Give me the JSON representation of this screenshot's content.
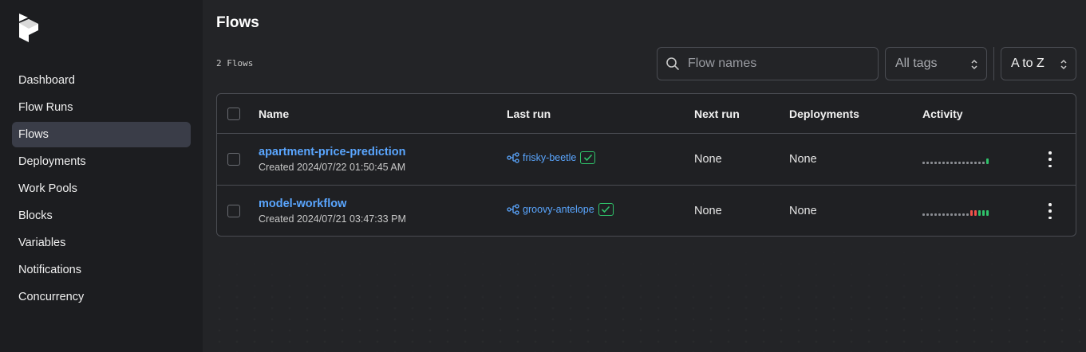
{
  "sidebar": {
    "items": [
      {
        "label": "Dashboard",
        "active": false
      },
      {
        "label": "Flow Runs",
        "active": false
      },
      {
        "label": "Flows",
        "active": true
      },
      {
        "label": "Deployments",
        "active": false
      },
      {
        "label": "Work Pools",
        "active": false
      },
      {
        "label": "Blocks",
        "active": false
      },
      {
        "label": "Variables",
        "active": false
      },
      {
        "label": "Notifications",
        "active": false
      },
      {
        "label": "Concurrency",
        "active": false
      }
    ]
  },
  "page": {
    "title": "Flows",
    "count_label": "2 Flows"
  },
  "filters": {
    "search_placeholder": "Flow names",
    "search_value": "",
    "tags_value": "All tags",
    "sort_value": "A to Z"
  },
  "table": {
    "columns": {
      "name": "Name",
      "last_run": "Last run",
      "next_run": "Next run",
      "deployments": "Deployments",
      "activity": "Activity"
    },
    "rows": [
      {
        "name": "apartment-price-prediction",
        "created": "Created 2024/07/22 01:50:45 AM",
        "last_run": "frisky-beetle",
        "last_run_state": "completed",
        "next_run": "None",
        "deployments": "None",
        "activity": [
          "empty",
          "empty",
          "empty",
          "empty",
          "empty",
          "empty",
          "empty",
          "empty",
          "empty",
          "empty",
          "empty",
          "empty",
          "empty",
          "empty",
          "empty",
          "empty",
          "ok"
        ]
      },
      {
        "name": "model-workflow",
        "created": "Created 2024/07/21 03:47:33 PM",
        "last_run": "groovy-antelope",
        "last_run_state": "completed",
        "next_run": "None",
        "deployments": "None",
        "activity": [
          "empty",
          "empty",
          "empty",
          "empty",
          "empty",
          "empty",
          "empty",
          "empty",
          "empty",
          "empty",
          "empty",
          "empty",
          "fail",
          "fail",
          "ok",
          "ok",
          "ok"
        ]
      }
    ]
  },
  "colors": {
    "link": "#5aa6ff",
    "success": "#2fc26a",
    "failure": "#f0524a",
    "active_nav": "#3a3d48"
  },
  "icons": {
    "logo": "prefect-logo",
    "search": "search-icon",
    "chevron": "chevron-up-down-icon",
    "flow_run": "flow-run-icon",
    "state": "check-icon",
    "row_menu": "vertical-ellipsis-icon"
  }
}
